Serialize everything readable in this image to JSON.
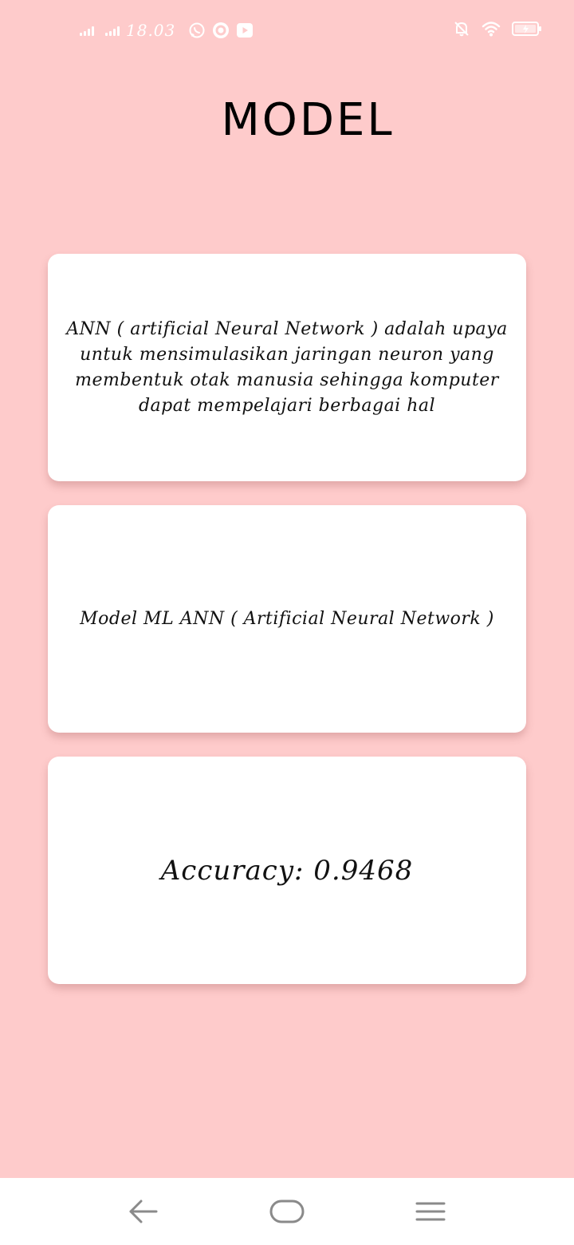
{
  "status_bar": {
    "time": "18.03",
    "icons": [
      "signal-1-icon",
      "signal-2-icon",
      "whatsapp-icon",
      "record-app-icon",
      "youtube-icon",
      "notifications-off-icon",
      "wifi-icon",
      "battery-icon"
    ],
    "text_color": "#ffffff"
  },
  "page": {
    "title": "MODEL",
    "background": "#fecbcb"
  },
  "cards": {
    "description": "ANN ( artificial Neural Network ) adalah upaya untuk mensimulasikan jaringan neuron yang membentuk otak manusia sehingga komputer dapat mempelajari berbagai hal",
    "model_name": "Model ML ANN ( Artificial Neural Network )",
    "accuracy": "Accuracy: 0.9468"
  },
  "nav_bar": {
    "icons": [
      "back-icon",
      "home-icon",
      "menu-icon"
    ]
  }
}
